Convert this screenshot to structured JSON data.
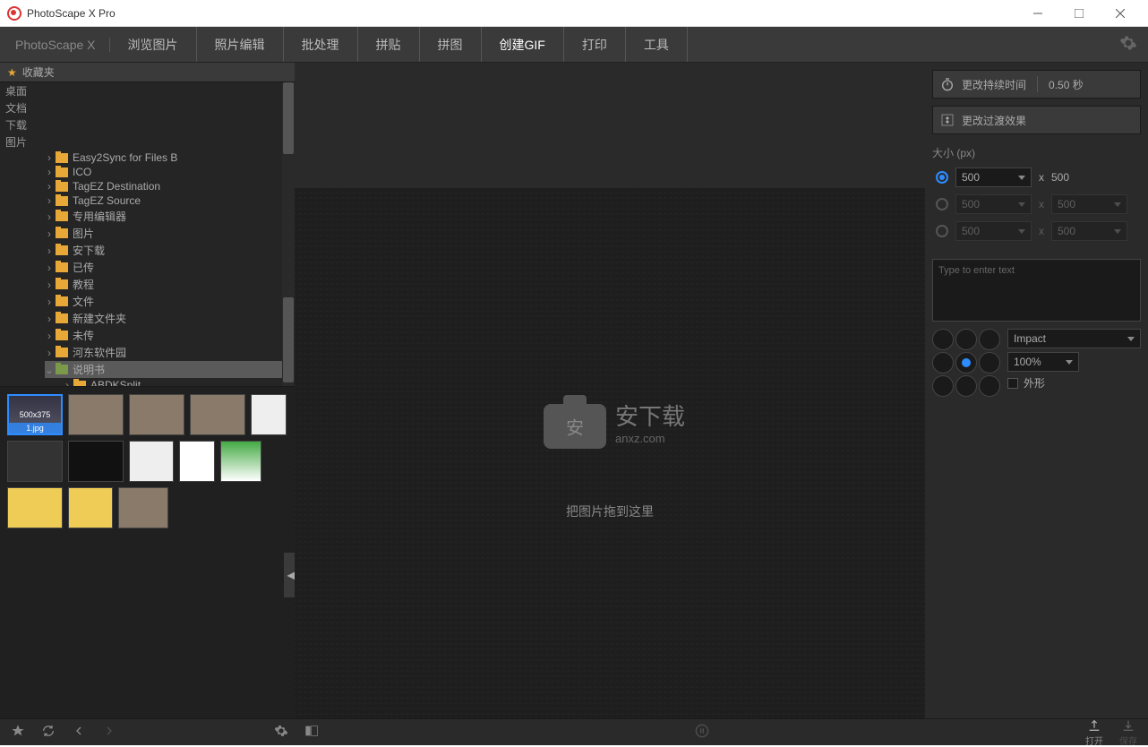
{
  "window": {
    "title": "PhotoScape X Pro"
  },
  "brand": "PhotoScape X",
  "menu": [
    "浏览图片",
    "照片编辑",
    "批处理",
    "拼贴",
    "拼图",
    "创建GIF",
    "打印",
    "工具"
  ],
  "menu_active": 5,
  "favorites": "收藏夹",
  "roots": [
    "桌面",
    "文档",
    "下载",
    "图片"
  ],
  "folders": [
    "Easy2Sync for Files B",
    "ICO",
    "TagEZ Destination",
    "TagEZ Source",
    "专用编辑器",
    "图片",
    "安下载",
    "已传",
    "教程",
    "文件",
    "新建文件夹",
    "未传",
    "河东软件园",
    "说明书",
    "ABDKSplit"
  ],
  "folder_sel": 13,
  "thumbs": {
    "first_label": "1.jpg",
    "first_text": "500x375"
  },
  "canvas": {
    "watermark": "安下载",
    "watermark_sub": "anxz.com",
    "drop": "把图片拖到这里"
  },
  "panel": {
    "duration": "更改持续时间",
    "duration_val": "0.50 秒",
    "transition": "更改过渡效果",
    "size_label": "大小 (px)",
    "size_val": "500",
    "size_x": "x",
    "size_val2": "500",
    "text_ph": "Type to enter text",
    "font": "Impact",
    "opacity": "100%",
    "outline": "外形"
  },
  "status": {
    "open": "打开",
    "save": "保存"
  }
}
